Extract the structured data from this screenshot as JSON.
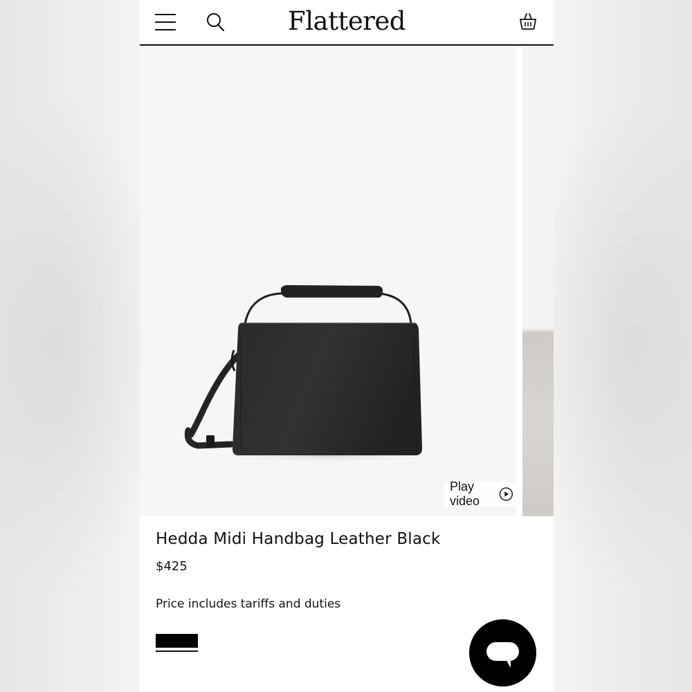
{
  "header": {
    "logo": "Flattered",
    "menu_icon": "hamburger-menu-icon",
    "search_icon": "search-icon",
    "cart_icon": "basket-icon"
  },
  "gallery": {
    "play_video_label": "Play video",
    "play_icon": "play-circle-icon"
  },
  "product": {
    "title": "Hedda Midi Handbag Leather Black",
    "price": "$425",
    "tariff_note": "Price includes tariffs and duties",
    "selected_color": "#000000"
  },
  "chat": {
    "icon": "chat-bubble-icon"
  },
  "colors": {
    "accent": "#000000",
    "text": "#111111",
    "image_background": "#f6f6f6"
  }
}
